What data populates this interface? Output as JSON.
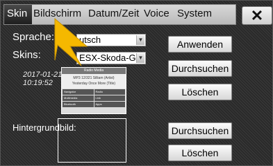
{
  "tabs": [
    {
      "label": "Skin",
      "active": true
    },
    {
      "label": "Bildschirm"
    },
    {
      "label": "Datum/Zeit"
    },
    {
      "label": "Voice"
    },
    {
      "label": "System"
    }
  ],
  "close_label": "✕",
  "language": {
    "label": "Sprache:",
    "value": "utsch"
  },
  "skins": {
    "label": "Skins:",
    "value": "ESX-Skoda-Gre"
  },
  "skin_date": "2017-01-21",
  "skin_time": "10:19:52",
  "preview": {
    "top": "Radio  Media",
    "mid1": "MP3 12/321   Silliam (Artist)",
    "mid2": "Yesterday Once More (Title)",
    "cells": [
      "Navigator",
      "Radio",
      "Multimedia",
      "Link",
      "Bluetooth",
      "Apps"
    ]
  },
  "background": {
    "label": "Hintergrundbild:"
  },
  "buttons": {
    "apply": "Anwenden",
    "browse1": "Durchsuchen",
    "delete1": "Löschen",
    "browse2": "Durchsuchen",
    "delete2": "Löschen"
  },
  "colors": {
    "cursor": "#f5b800"
  }
}
